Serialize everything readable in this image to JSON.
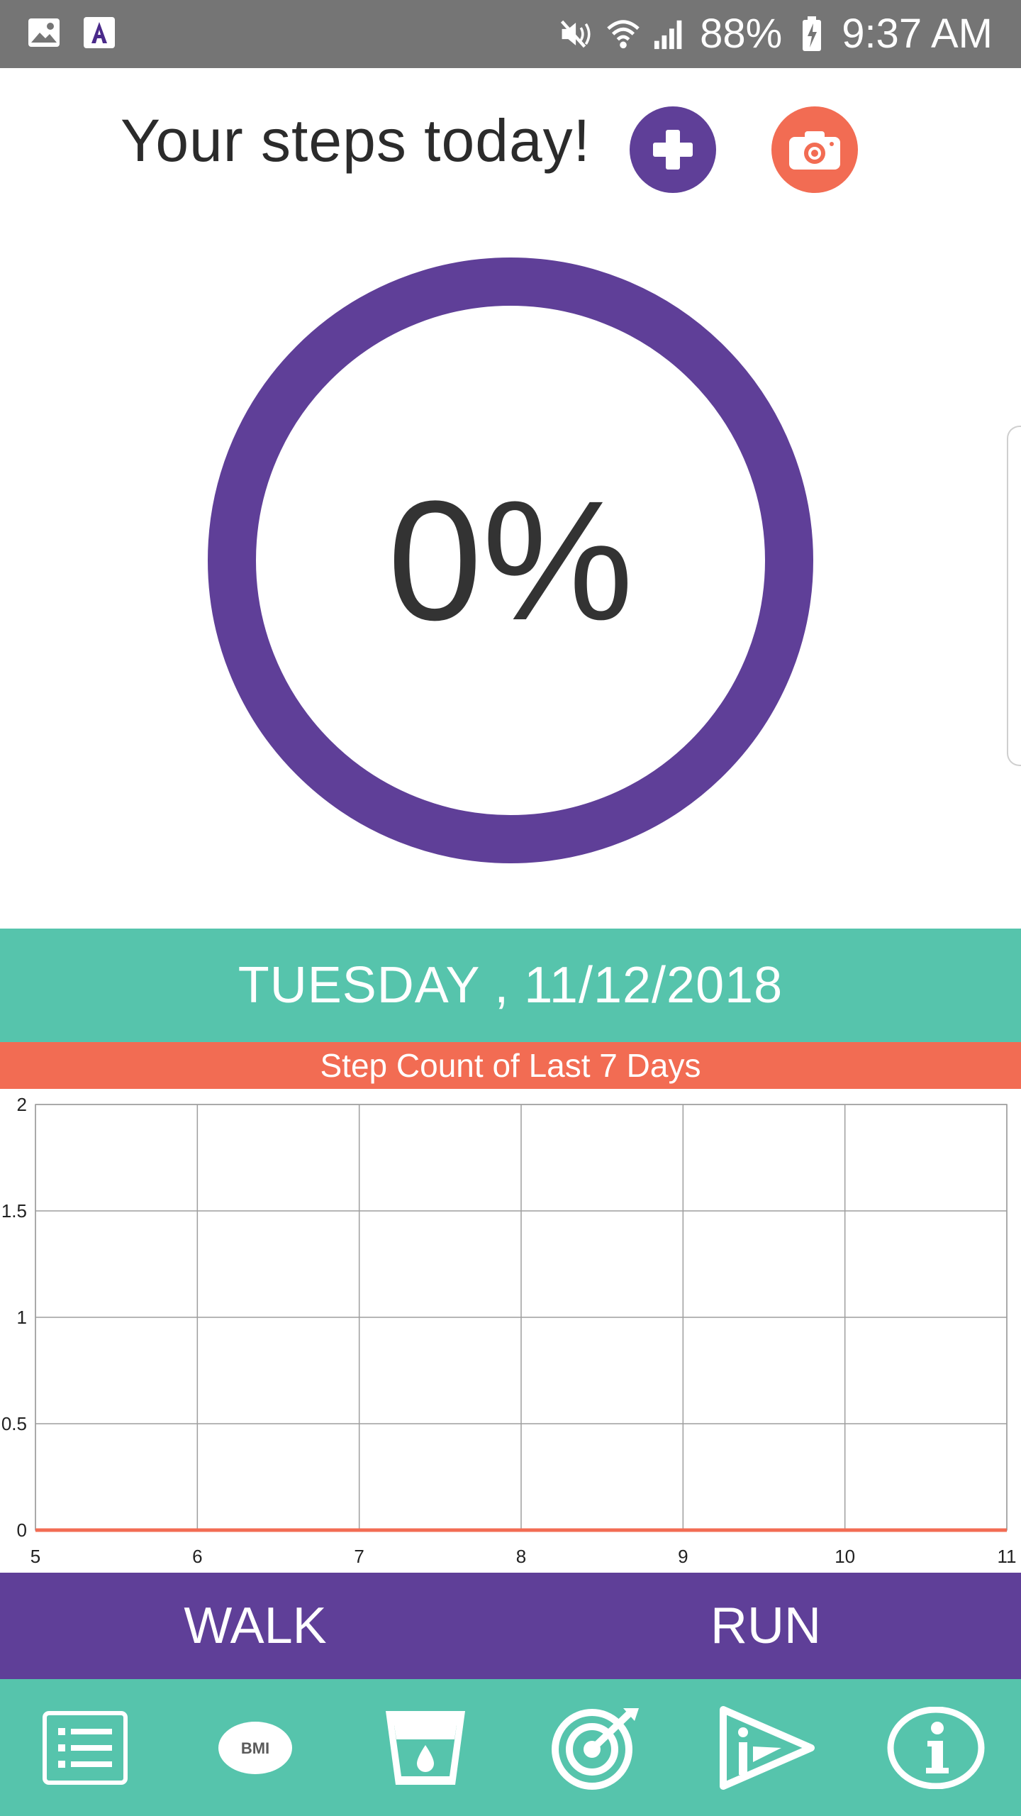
{
  "status_bar": {
    "battery": "88%",
    "time": "9:37 AM",
    "icons": [
      "gallery-icon",
      "app-a-icon",
      "mute-icon",
      "wifi-icon",
      "signal-icon",
      "battery-icon"
    ]
  },
  "header": {
    "title": "Your steps today!",
    "add_icon": "plus-icon",
    "camera_icon": "camera-icon"
  },
  "progress": {
    "percent_label": "0%",
    "value": 0
  },
  "date_banner": "TUESDAY , 11/12/2018",
  "chart_title": "Step Count of Last 7 Days",
  "chart_data": {
    "type": "line",
    "title": "Step Count of Last 7 Days",
    "x": [
      5,
      6,
      7,
      8,
      9,
      10,
      11
    ],
    "series": [
      {
        "values": [
          0,
          0,
          0,
          0,
          0,
          0,
          0
        ]
      }
    ],
    "x_ticks": [
      "5",
      "6",
      "7",
      "8",
      "9",
      "10",
      "11"
    ],
    "y_ticks": [
      "0",
      "0.5",
      "1",
      "1.5",
      "2"
    ],
    "ylim": [
      0,
      2
    ],
    "xlim": [
      5,
      11
    ],
    "grid": true,
    "line_color": "#f26c53"
  },
  "modes": {
    "walk": "WALK",
    "run": "RUN"
  },
  "bottom_nav": {
    "bmi_label": "BMI",
    "items": [
      "list-icon",
      "bmi-icon",
      "water-glass-icon",
      "target-icon",
      "play-icon",
      "info-icon"
    ]
  },
  "colors": {
    "purple": "#5f3f98",
    "teal": "#56c4ac",
    "coral": "#f26c53",
    "statusbar": "#757575"
  }
}
